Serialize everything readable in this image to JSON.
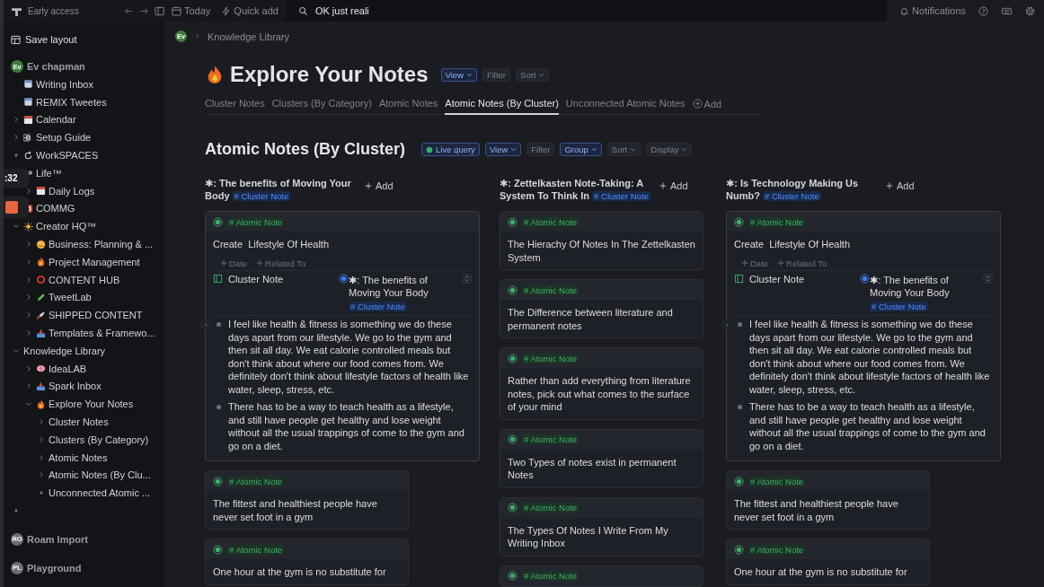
{
  "topbar": {
    "app_label": "Early access",
    "today": "Today",
    "quick_add": "Quick add",
    "search": {
      "value": "OK just reali"
    },
    "notifications": "Notifications"
  },
  "recorder": {
    "time": ":32"
  },
  "sidebar": {
    "save_layout": "Save layout",
    "workspaces": [
      {
        "avatar": "Ev",
        "color": "#3f7d3a",
        "name": "Ev chapman",
        "items": [
          {
            "label": "Writing Inbox",
            "kind": "page"
          },
          {
            "label": "REMIX Tweetes",
            "kind": "page"
          },
          {
            "label": "Calendar",
            "kind": "calendar",
            "expanded": false
          },
          {
            "label": "Setup Guide",
            "kind": "command",
            "expanded": false
          },
          {
            "label": "WorkSPACES",
            "kind": "refresh",
            "bullet": true
          },
          {
            "label": "Life™",
            "kind": "infinity",
            "children": [
              {
                "label": "Daily Logs",
                "kind": "calendar",
                "expanded": false
              }
            ]
          },
          {
            "label": "COMMG",
            "kind": "target"
          },
          {
            "label": "Creator HQ™",
            "kind": "sun",
            "expanded": true,
            "children": [
              {
                "label": "Business: Planning & ...",
                "kind": "smiley",
                "expanded": false
              },
              {
                "label": "Project Management",
                "kind": "flame",
                "expanded": false
              },
              {
                "label": "CONTENT HUB",
                "kind": "ring",
                "expanded": false
              },
              {
                "label": "TweetLab",
                "kind": "pencil",
                "expanded": false
              },
              {
                "label": "SHIPPED CONTENT",
                "kind": "rocket",
                "expanded": false
              },
              {
                "label": "Templates & Framewo...",
                "kind": "tray",
                "expanded": false
              }
            ]
          },
          {
            "label": "Knowledge Library",
            "expanded": true,
            "children": [
              {
                "label": "IdeaLAB",
                "kind": "brain",
                "expanded": false
              },
              {
                "label": "Spark Inbox",
                "kind": "tray",
                "expanded": false
              },
              {
                "label": "Explore Your Notes",
                "kind": "flame",
                "expanded": true,
                "children": [
                  {
                    "label": "Cluster Notes",
                    "expanded": false
                  },
                  {
                    "label": "Clusters (By Category)",
                    "expanded": false
                  },
                  {
                    "label": "Atomic Notes",
                    "expanded": false
                  },
                  {
                    "label": "Atomic Notes (By Clu...",
                    "expanded": false
                  },
                  {
                    "label": "Unconnected Atomic ...",
                    "bullet": true
                  }
                ]
              }
            ]
          },
          {
            "bullet": true
          }
        ]
      },
      {
        "avatar": "RO",
        "color": "#6b6d75",
        "name": "Roam Import"
      },
      {
        "avatar": "PL",
        "color": "#6b6d75",
        "name": "Playground"
      }
    ]
  },
  "breadcrumb": {
    "avatar": "Ev",
    "path": [
      "Knowledge Library"
    ]
  },
  "page": {
    "title": "Explore Your Notes",
    "buttons": [
      {
        "label": "View",
        "active": true,
        "caret": true
      },
      {
        "label": "Filter",
        "active": false,
        "caret": false
      },
      {
        "label": "Sort",
        "active": false,
        "caret": true
      }
    ],
    "tabs": [
      {
        "label": "Cluster Notes",
        "selected": false
      },
      {
        "label": "Clusters (By Category)",
        "selected": false
      },
      {
        "label": "Atomic Notes",
        "selected": false
      },
      {
        "label": "Atomic Notes (By Cluster)",
        "selected": true
      },
      {
        "label": "Unconnected Atomic Notes",
        "selected": false
      }
    ],
    "add_tab": "Add"
  },
  "section": {
    "title": "Atomic Notes (By Cluster)",
    "buttons": [
      {
        "label": "Live query",
        "kind": "live",
        "active": true,
        "caret": false
      },
      {
        "label": "View",
        "kind": "plain",
        "active": true,
        "caret": true
      },
      {
        "label": "Filter",
        "kind": "plain",
        "active": false,
        "caret": false
      },
      {
        "label": "Group",
        "kind": "plain",
        "active": true,
        "caret": true
      },
      {
        "label": "Sort",
        "kind": "plain",
        "active": false,
        "caret": true
      },
      {
        "label": "Display",
        "kind": "plain",
        "active": false,
        "caret": true
      }
    ]
  },
  "columns": [
    {
      "title": "✱: The benefits of Moving Your Body",
      "tag": "# Cluster Note",
      "add": "Add",
      "cards": [
        {
          "kind": "expanded",
          "tag": "# Atomic Note",
          "title": "Create  Lifestyle Of Health",
          "actions": [
            "Date",
            "Related To"
          ],
          "field": {
            "name": "Cluster Note",
            "value": "✱: The benefits of Moving Your Body",
            "tag": "# Cluster Note"
          },
          "bullets": [
            "I feel like health & fitness is something we do these days apart from our lifestyle. We go to the gym and then sit all day. We eat calorie controlled meals but don't think about where our food comes from. We definitely don't think about lifestyle factors of health like water, sleep, stress, etc.",
            "There has to be a way to teach health as a lifestyle, and still have people get healthy and lose weight without all the usual trappings of come to the gym and go on a diet."
          ]
        },
        {
          "kind": "simple",
          "tag": "# Atomic Note",
          "title": "The fittest and healthiest people have never set foot in a gym"
        },
        {
          "kind": "simple",
          "tag": "# Atomic Note",
          "title": "One hour at the gym is no substitute for"
        }
      ]
    },
    {
      "title": "✱: Zettelkasten Note-Taking: A System To Think In",
      "tag": "# Cluster Note",
      "add": "Add",
      "cards": [
        {
          "kind": "simple",
          "tag": "# Atomic Note",
          "title": "The Hierachy Of Notes In The Zettelkasten System"
        },
        {
          "kind": "simple",
          "tag": "# Atomic Note",
          "title": "The Difference between literature and permanent notes"
        },
        {
          "kind": "simple",
          "tag": "# Atomic Note",
          "title": "Rather than add everything from literature notes, pick out what comes to the surface of your mind"
        },
        {
          "kind": "simple",
          "tag": "# Atomic Note",
          "title": "Two Types of notes exist in permanent Notes"
        },
        {
          "kind": "simple",
          "tag": "# Atomic Note",
          "title": "The Types Of Notes I Write From My Writing Inbox"
        },
        {
          "kind": "simple",
          "tag": "# Atomic Note"
        }
      ]
    },
    {
      "title": "✱: Is Technology Making Us Numb?",
      "tag": "# Cluster Note",
      "add": "Add",
      "cards": [
        {
          "kind": "expanded",
          "tag": "# Atomic Note",
          "title": "Create  Lifestyle Of Health",
          "actions": [
            "Date",
            "Related To"
          ],
          "field": {
            "name": "Cluster Note",
            "value": "✱: The benefits of Moving Your Body",
            "tag": "# Cluster Note"
          },
          "bullets": [
            "I feel like health & fitness is something we do these days apart from our lifestyle. We go to the gym and then sit all day. We eat calorie controlled meals but don't think about where our food comes from. We definitely don't think about lifestyle factors of health like water, sleep, stress, etc.",
            "There has to be a way to teach health as a lifestyle, and still have people get healthy and lose weight without all the usual trappings of come to the gym and go on a diet."
          ]
        },
        {
          "kind": "simple",
          "tag": "# Atomic Note",
          "title": "The fittest and healthiest people have never set foot in a gym"
        },
        {
          "kind": "simple",
          "tag": "# Atomic Note",
          "title": "One hour at the gym is no substitute for"
        }
      ]
    }
  ]
}
